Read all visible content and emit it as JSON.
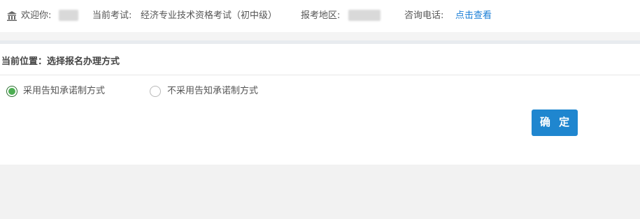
{
  "header": {
    "welcome_label": "欢迎你:",
    "exam_label": "当前考试:",
    "exam_value": "经济专业技术资格考试（初中级）",
    "region_label": "报考地区:",
    "phone_label": "咨询电话:",
    "phone_link": "点击查看",
    "icon": "bank-icon"
  },
  "panel": {
    "breadcrumb": "当前位置：选择报名办理方式",
    "options": [
      {
        "label": "采用告知承诺制方式",
        "selected": true
      },
      {
        "label": "不采用告知承诺制方式",
        "selected": false
      }
    ],
    "confirm_label": "确 定"
  },
  "colors": {
    "accent": "#1f86cf",
    "link": "#1a7ed6",
    "radio_selected": "#4cae52"
  }
}
